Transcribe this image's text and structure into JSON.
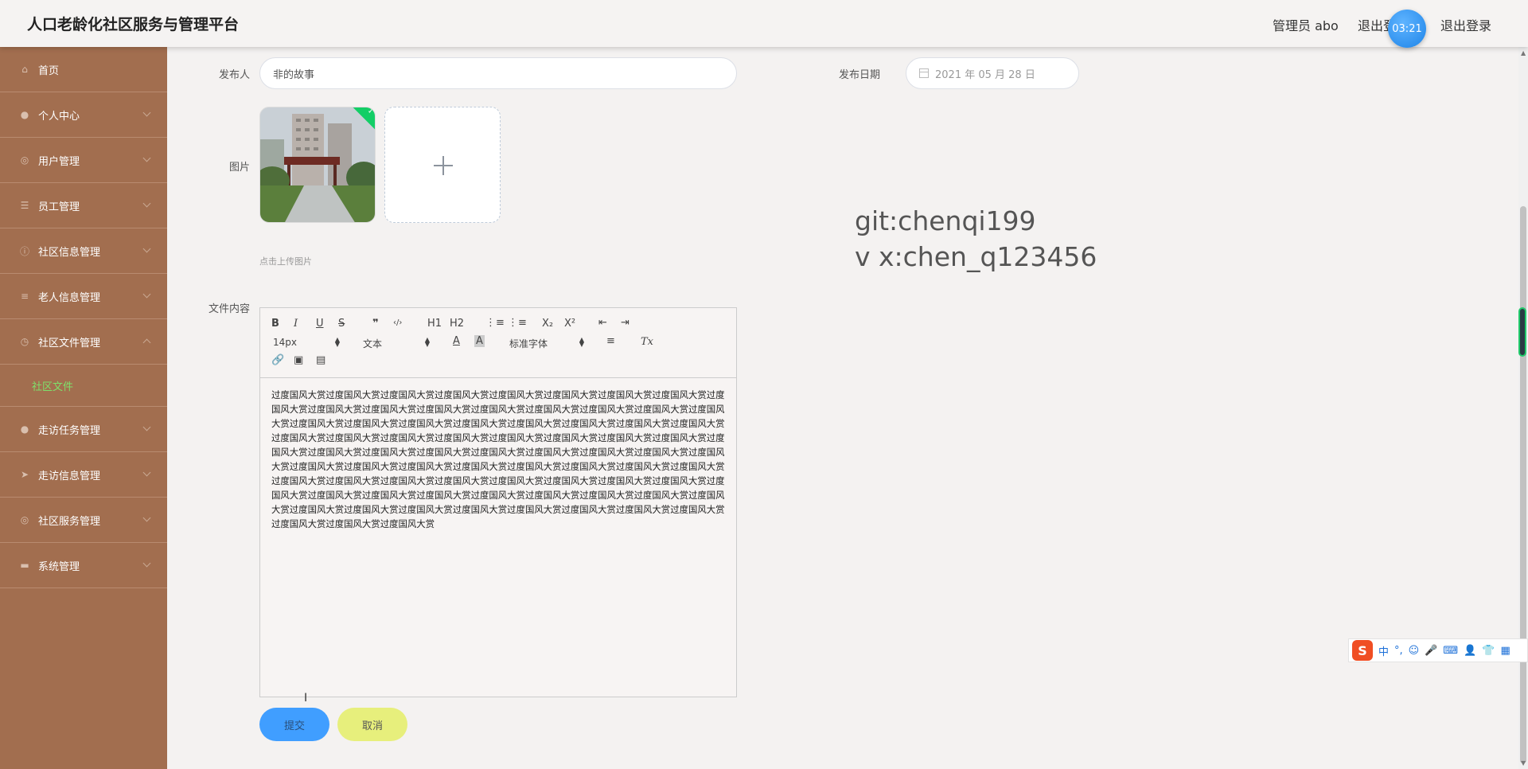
{
  "header": {
    "title": "人口老龄化社区服务与管理平台",
    "admin": "管理员 abo",
    "logout_partial": "退出登录",
    "logout": "退出登录",
    "timer": "03:21"
  },
  "sidebar": {
    "items": [
      {
        "label": "首页",
        "icon": "home-icon",
        "expanded": false
      },
      {
        "label": "个人中心",
        "icon": "user-icon",
        "expanded": false
      },
      {
        "label": "用户管理",
        "icon": "globe-icon",
        "expanded": false
      },
      {
        "label": "员工管理",
        "icon": "sliders-icon",
        "expanded": false
      },
      {
        "label": "社区信息管理",
        "icon": "info-icon",
        "expanded": false
      },
      {
        "label": "老人信息管理",
        "icon": "list-icon",
        "expanded": false
      },
      {
        "label": "社区文件管理",
        "icon": "clock-icon",
        "expanded": true
      },
      {
        "label": "走访任务管理",
        "icon": "user-icon",
        "expanded": false
      },
      {
        "label": "走访信息管理",
        "icon": "send-icon",
        "expanded": false
      },
      {
        "label": "社区服务管理",
        "icon": "globe-icon",
        "expanded": false
      },
      {
        "label": "系统管理",
        "icon": "chat-icon",
        "expanded": false
      }
    ],
    "sub_item": "社区文件"
  },
  "form": {
    "publisher_label": "发布人",
    "publisher_value": "非的故事",
    "date_label": "发布日期",
    "date_value": "2021 年 05 月 28 日",
    "image_label": "图片",
    "upload_hint": "点击上传图片",
    "content_label": "文件内容",
    "submit": "提交",
    "cancel": "取消"
  },
  "editor": {
    "toolbar": {
      "bold": "B",
      "italic": "I",
      "underline": "U",
      "strike": "S",
      "quote": "❞",
      "code": "‹/›",
      "h1": "H1",
      "h2": "H2",
      "ol": "⋮≡",
      "ul": "⋮≡",
      "sub": "X₂",
      "sup": "X²",
      "outdent": "⇤",
      "indent": "⇥",
      "size": "14px",
      "header_select": "文本",
      "font": "标准字体",
      "clean": "Tx"
    },
    "content": "过度国风大赏过度国风大赏过度国风大赏过度国风大赏过度国风大赏过度国风大赏过度国风大赏过度国风大赏过度国风大赏过度国风大赏过度国风大赏过度国风大赏过度国风大赏过度国风大赏过度国风大赏过度国风大赏过度国风大赏过度国风大赏过度国风大赏过度国风大赏过度国风大赏过度国风大赏过度国风大赏过度国风大赏过度国风大赏过度国风大赏过度国风大赏过度国风大赏过度国风大赏过度国风大赏过度国风大赏过度国风大赏过度国风大赏过度国风大赏过度国风大赏过度国风大赏过度国风大赏过度国风大赏过度国风大赏过度国风大赏过度国风大赏过度国风大赏过度国风大赏过度国风大赏过度国风大赏过度国风大赏过度国风大赏过度国风大赏过度国风大赏过度国风大赏过度国风大赏过度国风大赏过度国风大赏过度国风大赏过度国风大赏过度国风大赏过度国风大赏过度国风大赏过度国风大赏过度国风大赏过度国风大赏过度国风大赏过度国风大赏过度国风大赏过度国风大赏过度国风大赏过度国风大赏过度国风大赏过度国风大赏过度国风大赏过度国风大赏过度国风大赏过度国风大赏过度国风大赏过度国风大赏过度国风大赏过度国风大赏过度国风大赏"
  },
  "watermark": {
    "line1": "git:chenqi199",
    "line2": "v x:chen_q123456"
  },
  "ime": {
    "zh": "中",
    "punct": "°,"
  },
  "colors": {
    "sidebar": "#a26e4f",
    "active_sub": "#7ee06b",
    "submit": "#409eff",
    "cancel": "#e7ef7c"
  }
}
